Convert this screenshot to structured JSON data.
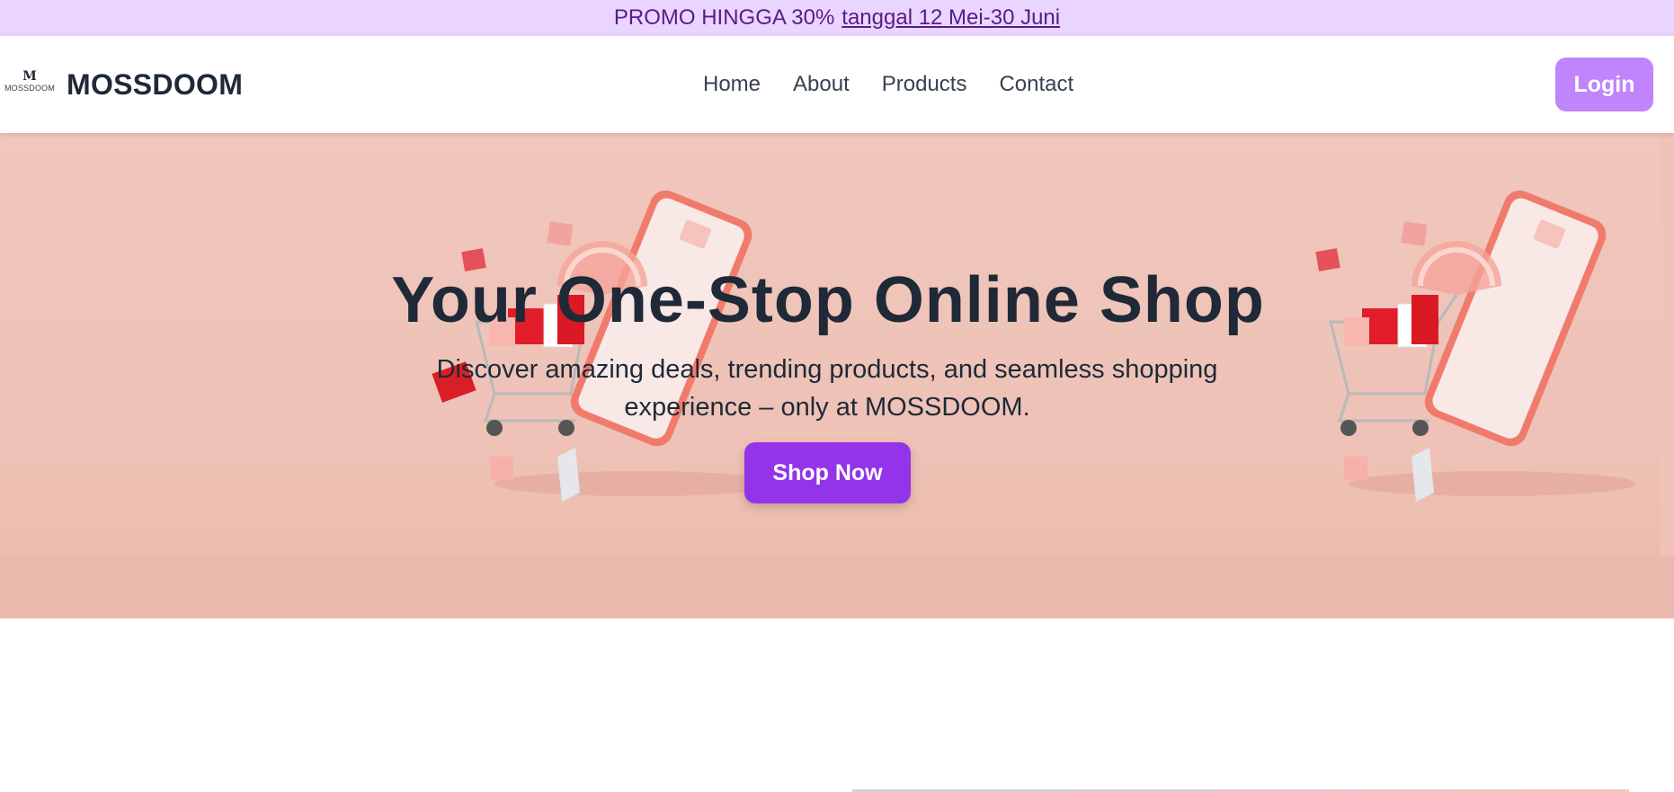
{
  "promo": {
    "text": "PROMO HINGGA 30%",
    "link_text": "tanggal 12 Mei-30 Juni"
  },
  "brand": {
    "logo_letter": "M",
    "logo_small_text": "MOSSDOOM",
    "name": "MOSSDOOM"
  },
  "nav": {
    "links": [
      "Home",
      "About",
      "Products",
      "Contact"
    ],
    "login_label": "Login"
  },
  "hero": {
    "title": "Your One-Stop Online Shop",
    "subtitle": "Discover amazing deals, trending products, and seamless shopping experience – only at MOSSDOOM.",
    "cta_label": "Shop Now"
  },
  "colors": {
    "promo_bg": "#e9d5ff",
    "promo_text": "#581c87",
    "login_bg": "#c084fc",
    "cta_bg": "#9333ea",
    "hero_bg": "#efc3b8",
    "heading_text": "#1f2937"
  },
  "icons": {
    "hero_art": "phone-shopping-cart-gifts-illustration"
  }
}
